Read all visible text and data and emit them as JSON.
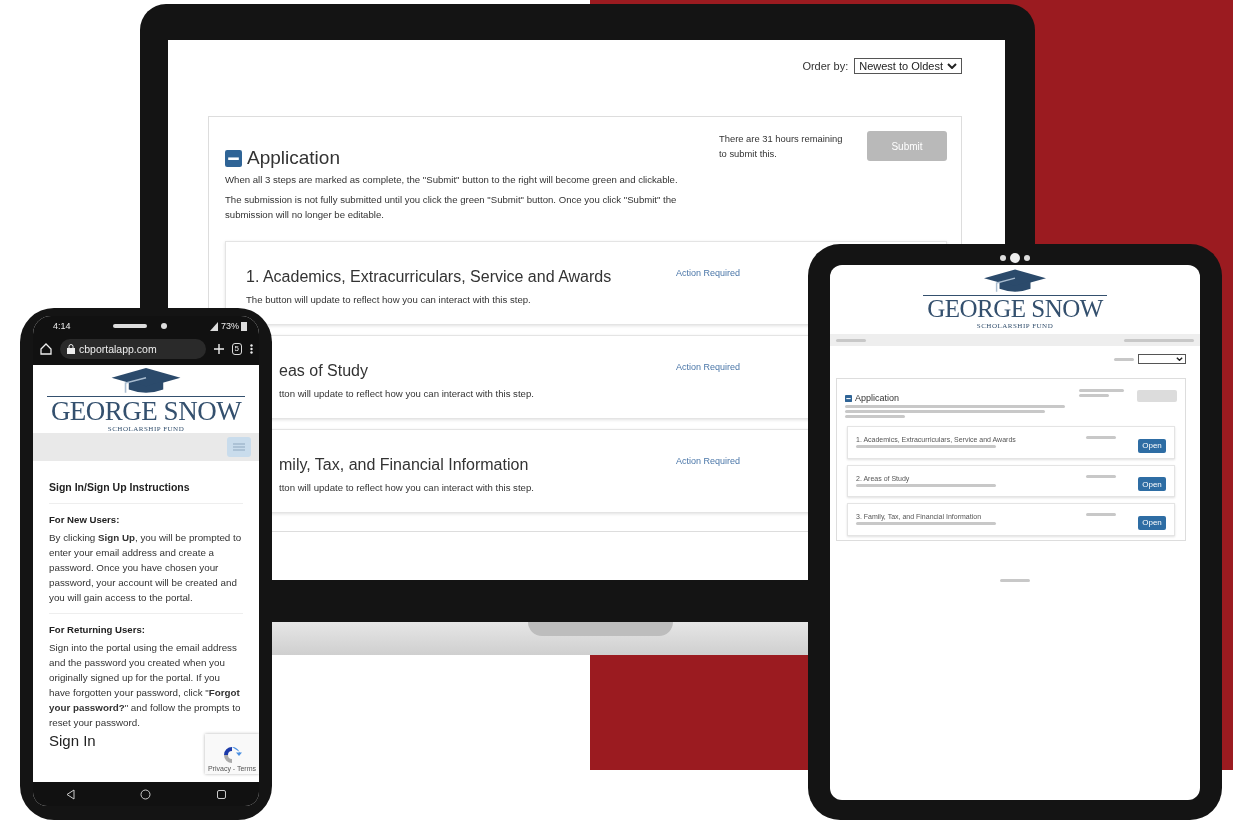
{
  "laptop": {
    "order_by": {
      "label": "Order by:",
      "value": "Newest to Oldest"
    },
    "application": {
      "title": "Application",
      "notes": [
        "When all 3 steps are marked as complete, the \"Submit\" button to the right will become green and clickable.",
        "The submission is not fully submitted until you click the green \"Submit\" button. Once you click \"Submit\" the submission will no longer be editable."
      ],
      "remaining": "There are 31 hours remaining to submit this.",
      "submit": {
        "label": "Submit",
        "disabled": true
      }
    },
    "steps": [
      {
        "title": "1. Academics, Extracurriculars, Service and Awards",
        "description": "The button will update to reflect how you can interact with this step.",
        "status": "Action Required"
      },
      {
        "title": "eas of Study",
        "description": "tton will update to reflect how you can interact with this step.",
        "status": "Action Required"
      },
      {
        "title": "mily, Tax, and Financial Information",
        "description": "tton will update to reflect how you can interact with this step.",
        "status": "Action Required"
      }
    ]
  },
  "phone": {
    "status_bar": {
      "time": "4:14",
      "battery": "73%"
    },
    "url": "cbportalapp.com",
    "tab_count": "5",
    "logo": {
      "name": "GEORGE SNOW",
      "subtitle": "SCHOLARSHIP FUND"
    },
    "instructions_title": "Sign In/Sign Up Instructions",
    "sections": [
      {
        "heading": "For New Users:",
        "text": "By clicking **Sign Up**, you will be prompted to enter your email address and create a password. Once you have chosen your password, your account will be created and you will gain access to the portal."
      },
      {
        "heading": "For Returning Users:",
        "text": "Sign into the portal using the email address and the password you created when you originally signed up for the portal. If you have forgotten your password, click \"**Forgot your password?**\" and follow the prompts to reset your password."
      }
    ],
    "sign_in_heading": "Sign In",
    "recaptcha": "Privacy - Terms"
  },
  "tablet": {
    "logo": {
      "name": "GEORGE SNOW",
      "subtitle": "SCHOLARSHIP FUND"
    },
    "application": {
      "title": "Application",
      "submit": {
        "disabled": true
      }
    },
    "steps": [
      {
        "title": "1. Academics, Extracurriculars, Service and Awards",
        "button": "Open"
      },
      {
        "title": "2. Areas of Study",
        "button": "Open"
      },
      {
        "title": "3. Family, Tax, and Financial Information",
        "button": "Open"
      }
    ]
  }
}
